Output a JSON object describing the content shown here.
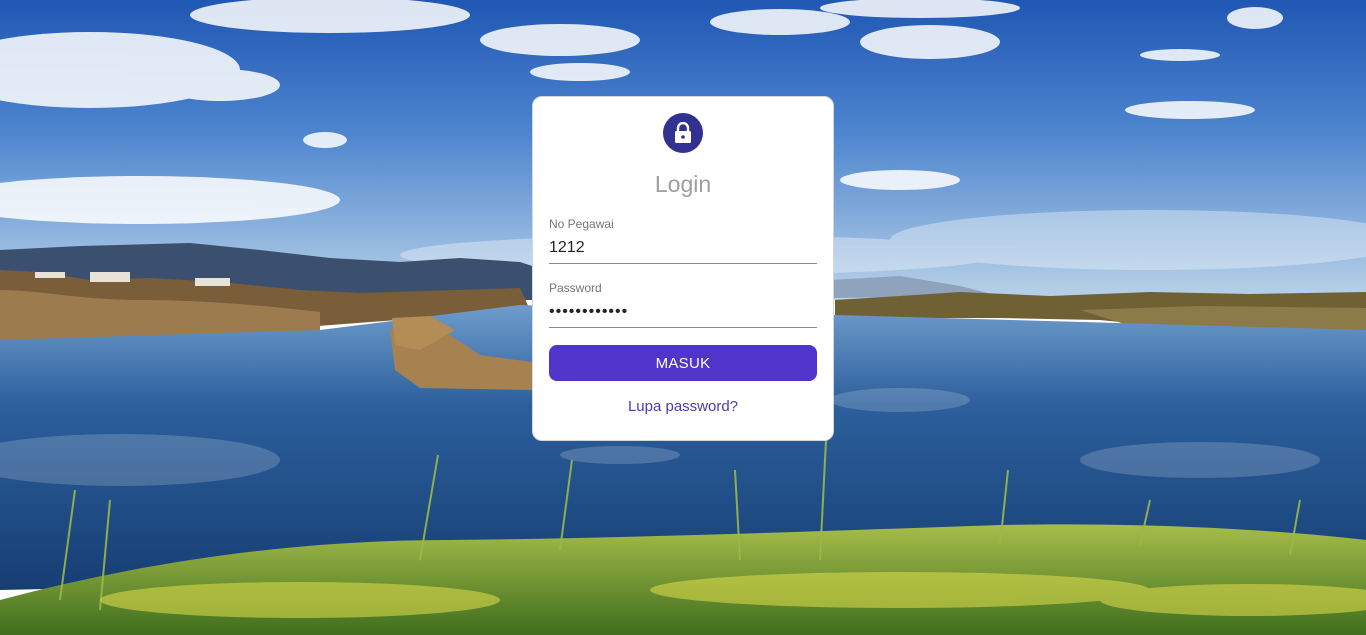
{
  "colors": {
    "accent": "#4f35c9",
    "lock_badge": "#303190",
    "link": "#4a3bb8",
    "title": "#9e9e9e"
  },
  "login_card": {
    "icon": "lock-icon",
    "title": "Login",
    "employee_field": {
      "label": "No Pegawai",
      "value": "1212"
    },
    "password_field": {
      "label": "Password",
      "value": "123456789012"
    },
    "submit_label": "MASUK",
    "forgot_password_label": "Lupa password?"
  }
}
